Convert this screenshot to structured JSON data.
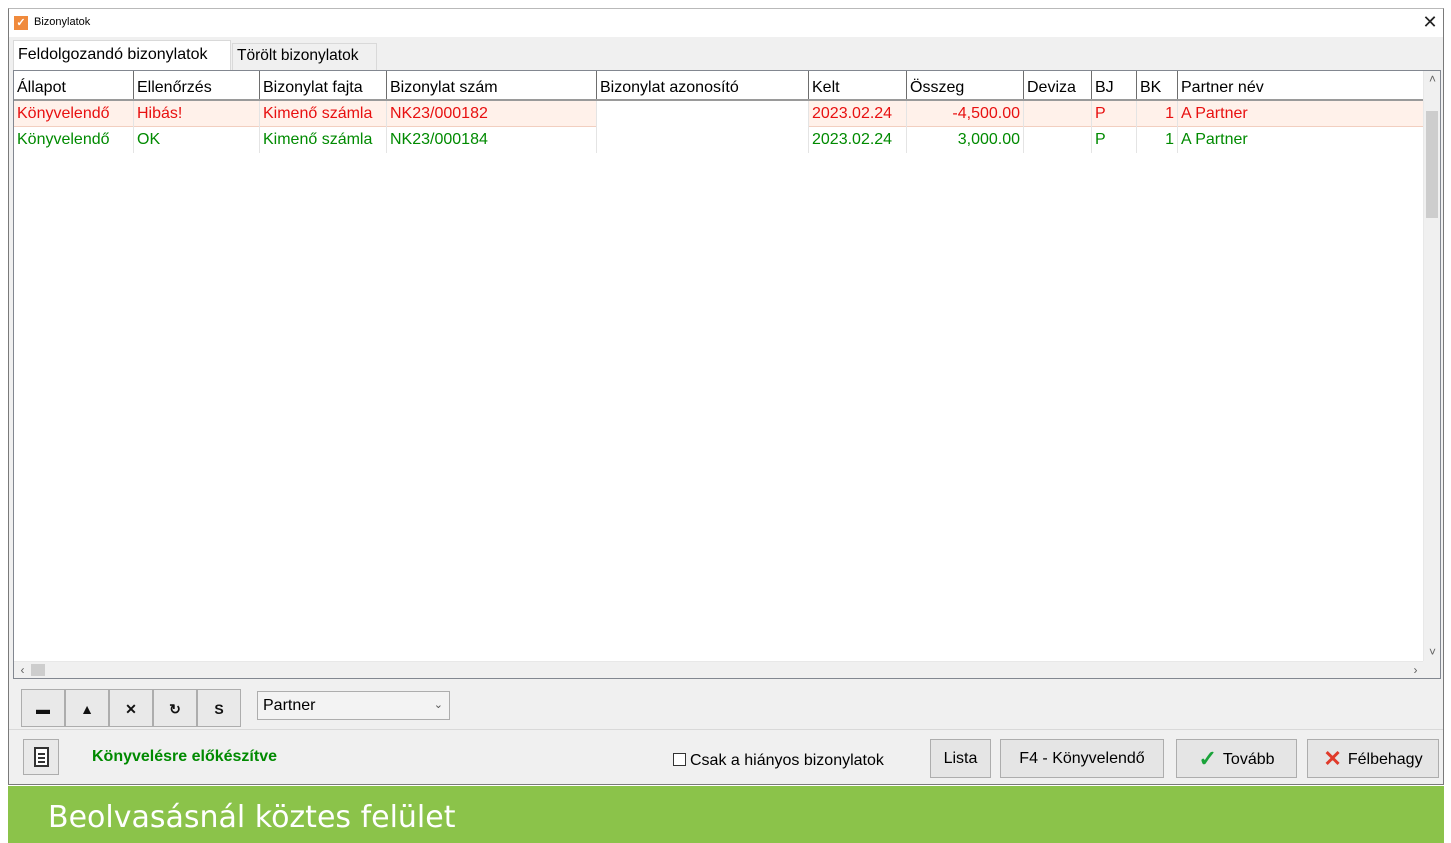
{
  "window": {
    "title": "Bizonylatok",
    "close_icon": "close-icon",
    "close_glyph": "✕"
  },
  "tabs": [
    {
      "label": "Feldolgozandó bizonylatok",
      "active": true
    },
    {
      "label": "Törölt bizonylatok",
      "active": false
    }
  ],
  "grid": {
    "columns": [
      "Állapot",
      "Ellenőrzés",
      "Bizonylat fajta",
      "Bizonylat szám",
      "Bizonylat azonosító",
      "Kelt",
      "Összeg",
      "Deviza",
      "BJ",
      "BK",
      "Partner név"
    ],
    "rows": [
      {
        "allapot": "Könyvelendő",
        "ellenorzes": "Hibás!",
        "fajta": "Kimenő számla",
        "szam": "NK23/000182",
        "azonosito": "",
        "kelt": "2023.02.24",
        "osszeg": "-4,500.00",
        "deviza": "",
        "bj": "P",
        "bk": "1",
        "partner": "A Partner",
        "color": "#e81010"
      },
      {
        "allapot": "Könyvelendő",
        "ellenorzes": "OK",
        "fajta": "Kimenő számla",
        "szam": "NK23/000184",
        "azonosito": "",
        "kelt": "2023.02.24",
        "osszeg": "3,000.00",
        "deviza": "",
        "bj": "P",
        "bk": "1",
        "partner": "A Partner",
        "color": "#008a00"
      }
    ]
  },
  "nav_buttons": [
    {
      "glyph": "▬",
      "icon": "delete-icon"
    },
    {
      "glyph": "▲",
      "icon": "up-icon"
    },
    {
      "glyph": "✕",
      "icon": "cancel-icon"
    },
    {
      "glyph": "↻",
      "icon": "refresh-icon"
    },
    {
      "glyph": "S",
      "icon": "save-icon"
    }
  ],
  "filter_select": {
    "value": "Partner"
  },
  "status_text": "Könyvelésre előkészítve",
  "checkbox": {
    "label": "Csak a hiányos bizonylatok",
    "checked": false
  },
  "buttons": {
    "lista": "Lista",
    "f4": "F4 - Könyvelendő",
    "tovabb": "Tovább",
    "felbehagy": "Félbehagy"
  },
  "footer_caption": "Beolvasásnál köztes felület",
  "colors": {
    "error": "#e81010",
    "ok": "#008a00",
    "footer": "#8bc34a",
    "app_icon": "#f08a3c"
  }
}
